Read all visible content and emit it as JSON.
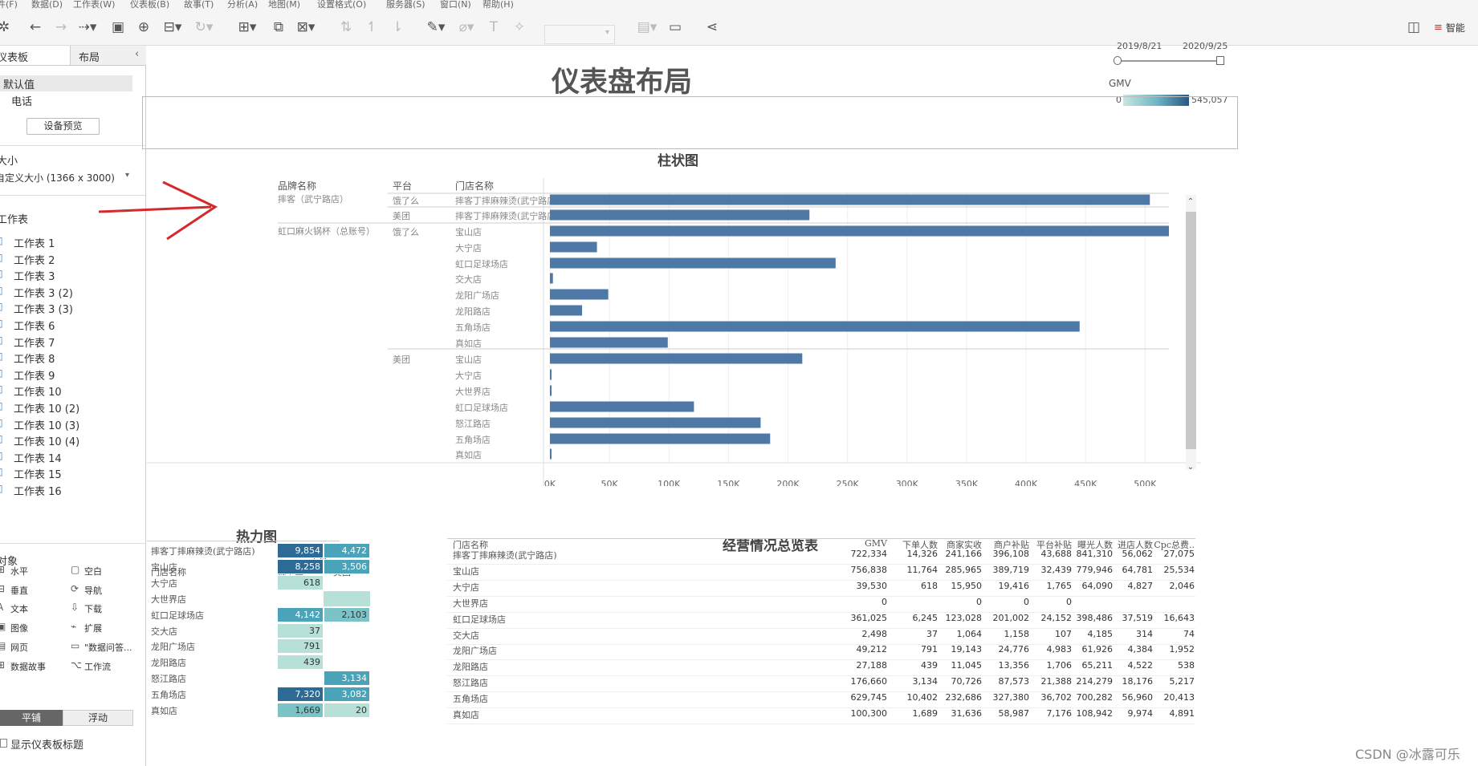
{
  "menu": [
    "件(F)",
    "数据(D)",
    "工作表(W)",
    "仪表板(B)",
    "故事(T)",
    "分析(A)",
    "地图(M)",
    "设置格式(O)",
    "服务器(S)",
    "窗口(N)",
    "帮助(H)"
  ],
  "toolbar": {
    "smart_label": "智能"
  },
  "sidebar": {
    "tab_dashboard": "仪表板",
    "tab_layout": "布局",
    "device_default": "默认值",
    "device_phone": "电话",
    "device_preview_btn": "设备预览",
    "size_title": "大小",
    "size_value": "自定义大小 (1366 x 3000)",
    "sheets_title": "工作表",
    "sheets": [
      "工作表 1",
      "工作表 2",
      "工作表 3",
      "工作表 3 (2)",
      "工作表 3 (3)",
      "工作表 6",
      "工作表 7",
      "工作表 8",
      "工作表 9",
      "工作表 10",
      "工作表 10 (2)",
      "工作表 10 (3)",
      "工作表 10 (4)",
      "工作表 14",
      "工作表 15",
      "工作表 16"
    ],
    "objects_title": "对象",
    "objects": [
      [
        "水平",
        "空白"
      ],
      [
        "垂直",
        "导航"
      ],
      [
        "文本",
        "下载"
      ],
      [
        "图像",
        "扩展"
      ],
      [
        "网页",
        "\"数据问答..."
      ],
      [
        "数据故事",
        "工作流"
      ]
    ],
    "tile_btn": "平铺",
    "float_btn": "浮动",
    "show_title": "显示仪表板标题"
  },
  "dashboard": {
    "title": "仪表盘布局",
    "date_start": "2019/8/21",
    "date_end": "2020/9/25",
    "legend_title": "GMV",
    "legend_min": "0",
    "legend_max": "545,057",
    "bar_title": "柱状图",
    "bar_headers": [
      "品牌名称",
      "平台",
      "门店名称"
    ],
    "brand1": "摔客（武宁路店）",
    "brand2": "虹口麻火锅杯（总账号）",
    "heat_title": "热力图",
    "heat_platform": "平台",
    "heat_headers": [
      "门店名称",
      "饿了么",
      "美团"
    ],
    "heat_rows": [
      [
        "摔客丁摔麻辣烫(武宁路店)",
        "9,854",
        "4,472"
      ],
      [
        "宝山店",
        "8,258",
        "3,506"
      ],
      [
        "大宁店",
        "618",
        ""
      ],
      [
        "大世界店",
        "",
        ""
      ],
      [
        "虹口足球场店",
        "4,142",
        "2,103"
      ],
      [
        "交大店",
        "37",
        ""
      ],
      [
        "龙阳广场店",
        "791",
        ""
      ],
      [
        "龙阳路店",
        "439",
        ""
      ],
      [
        "怒江路店",
        "",
        "3,134"
      ],
      [
        "五角场店",
        "7,320",
        "3,082"
      ],
      [
        "真如店",
        "1,669",
        "20"
      ]
    ],
    "table_title": "经营情况总览表",
    "table_headers": [
      "门店名称",
      "GMV",
      "下单人数",
      "商家实收",
      "商户补贴",
      "平台补贴",
      "曝光人数",
      "进店人数",
      "Cpc总费.."
    ],
    "table_rows": [
      [
        "摔客丁摔麻辣烫(武宁路店)",
        "722,334",
        "14,326",
        "241,166",
        "396,108",
        "43,688",
        "841,310",
        "56,062",
        "27,075"
      ],
      [
        "宝山店",
        "756,838",
        "11,764",
        "285,965",
        "389,719",
        "32,439",
        "779,946",
        "64,781",
        "25,534"
      ],
      [
        "大宁店",
        "39,530",
        "618",
        "15,950",
        "19,416",
        "1,765",
        "64,090",
        "4,827",
        "2,046"
      ],
      [
        "大世界店",
        "0",
        "",
        "0",
        "0",
        "0",
        "",
        "",
        ""
      ],
      [
        "虹口足球场店",
        "361,025",
        "6,245",
        "123,028",
        "201,002",
        "24,152",
        "398,486",
        "37,519",
        "16,643"
      ],
      [
        "交大店",
        "2,498",
        "37",
        "1,064",
        "1,158",
        "107",
        "4,185",
        "314",
        "74"
      ],
      [
        "龙阳广场店",
        "49,212",
        "791",
        "19,143",
        "24,776",
        "4,983",
        "61,926",
        "4,384",
        "1,952"
      ],
      [
        "龙阳路店",
        "27,188",
        "439",
        "11,045",
        "13,356",
        "1,706",
        "65,211",
        "4,522",
        "538"
      ],
      [
        "怒江路店",
        "176,660",
        "3,134",
        "70,726",
        "87,573",
        "21,388",
        "214,279",
        "18,176",
        "5,217"
      ],
      [
        "五角场店",
        "629,745",
        "10,402",
        "232,686",
        "327,380",
        "36,702",
        "700,282",
        "56,960",
        "20,413"
      ],
      [
        "真如店",
        "100,300",
        "1,689",
        "31,636",
        "58,987",
        "7,176",
        "108,942",
        "9,974",
        "4,891"
      ]
    ],
    "watermark": "CSDN @冰露可乐"
  },
  "chart_data": {
    "type": "bar",
    "title": "柱状图",
    "orientation": "horizontal",
    "xlim": [
      0,
      520000
    ],
    "xticks": [
      "0K",
      "50K",
      "100K",
      "150K",
      "200K",
      "250K",
      "300K",
      "350K",
      "400K",
      "450K",
      "500K"
    ],
    "rows": [
      {
        "brand": "摔客（武宁路店）",
        "platform": "饿了么",
        "store": "摔客丁摔麻辣烫(武宁路店)",
        "value": 504000
      },
      {
        "brand": "摔客（武宁路店）",
        "platform": "美团",
        "store": "摔客丁摔麻辣烫(武宁路店)",
        "value": 218000
      },
      {
        "brand": "虹口麻火锅杯（总账号）",
        "platform": "饿了么",
        "store": "宝山店",
        "value": 520000
      },
      {
        "brand": "虹口麻火锅杯（总账号）",
        "platform": "饿了么",
        "store": "大宁店",
        "value": 39500
      },
      {
        "brand": "虹口麻火锅杯（总账号）",
        "platform": "饿了么",
        "store": "虹口足球场店",
        "value": 240000
      },
      {
        "brand": "虹口麻火锅杯（总账号）",
        "platform": "饿了么",
        "store": "交大店",
        "value": 2500
      },
      {
        "brand": "虹口麻火锅杯（总账号）",
        "platform": "饿了么",
        "store": "龙阳广场店",
        "value": 49000
      },
      {
        "brand": "虹口麻火锅杯（总账号）",
        "platform": "饿了么",
        "store": "龙阳路店",
        "value": 27000
      },
      {
        "brand": "虹口麻火锅杯（总账号）",
        "platform": "饿了么",
        "store": "五角场店",
        "value": 445000
      },
      {
        "brand": "虹口麻火锅杯（总账号）",
        "platform": "饿了么",
        "store": "真如店",
        "value": 99000
      },
      {
        "brand": "虹口麻火锅杯（总账号）",
        "platform": "美团",
        "store": "宝山店",
        "value": 212000
      },
      {
        "brand": "虹口麻火锅杯（总账号）",
        "platform": "美团",
        "store": "大宁店",
        "value": 300
      },
      {
        "brand": "虹口麻火锅杯（总账号）",
        "platform": "美团",
        "store": "大世界店",
        "value": 300
      },
      {
        "brand": "虹口麻火锅杯（总账号）",
        "platform": "美团",
        "store": "虹口足球场店",
        "value": 121000
      },
      {
        "brand": "虹口麻火锅杯（总账号）",
        "platform": "美团",
        "store": "怒江路店",
        "value": 177000
      },
      {
        "brand": "虹口麻火锅杯（总账号）",
        "platform": "美团",
        "store": "五角场店",
        "value": 185000
      },
      {
        "brand": "虹口麻火锅杯（总账号）",
        "platform": "美团",
        "store": "真如店",
        "value": 1300
      }
    ],
    "color": "#4e79a7",
    "grid": true
  }
}
